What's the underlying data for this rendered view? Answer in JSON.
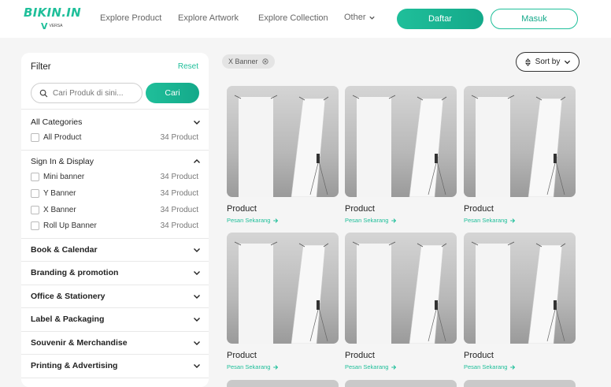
{
  "header": {
    "logo_text": "BIKIN.IN",
    "logo_sub_mark": "V",
    "logo_sub_text": "VERSA",
    "nav": [
      "Explore Product",
      "Explore Artwork",
      "Explore Collection"
    ],
    "nav_other": "Other",
    "daftar_label": "Daftar",
    "masuk_label": "Masuk",
    "accent": "#1fbf9a"
  },
  "filter": {
    "title": "Filter",
    "reset": "Reset",
    "search_placeholder": "Cari Produk di sini...",
    "search_button": "Cari",
    "categories": [
      {
        "label": "All Categories",
        "bold": false,
        "expanded": true,
        "options": [
          {
            "label": "All Product",
            "count": "34 Product"
          }
        ]
      },
      {
        "label": "Sign In & Display",
        "bold": false,
        "expanded": true,
        "options": [
          {
            "label": "Mini banner",
            "count": "34 Product"
          },
          {
            "label": "Y Banner",
            "count": "34 Product"
          },
          {
            "label": "X Banner",
            "count": "34 Product"
          },
          {
            "label": "Roll Up Banner",
            "count": "34 Product"
          }
        ]
      },
      {
        "label": "Book & Calendar",
        "bold": true,
        "expanded": false,
        "options": []
      },
      {
        "label": "Branding & promotion",
        "bold": true,
        "expanded": false,
        "options": []
      },
      {
        "label": "Office & Stationery",
        "bold": true,
        "expanded": false,
        "options": []
      },
      {
        "label": "Label & Packaging",
        "bold": true,
        "expanded": false,
        "options": []
      },
      {
        "label": "Souvenir & Merchandise",
        "bold": true,
        "expanded": false,
        "options": []
      },
      {
        "label": "Printing & Advertising",
        "bold": true,
        "expanded": false,
        "options": []
      }
    ]
  },
  "active_chip": "X Banner",
  "sort_label": "Sort by",
  "products": [
    {
      "title": "Product",
      "cta": "Pesan Sekarang"
    },
    {
      "title": "Product",
      "cta": "Pesan Sekarang"
    },
    {
      "title": "Product",
      "cta": "Pesan Sekarang"
    },
    {
      "title": "Product",
      "cta": "Pesan Sekarang"
    },
    {
      "title": "Product",
      "cta": "Pesan Sekarang"
    },
    {
      "title": "Product",
      "cta": "Pesan Sekarang"
    }
  ]
}
